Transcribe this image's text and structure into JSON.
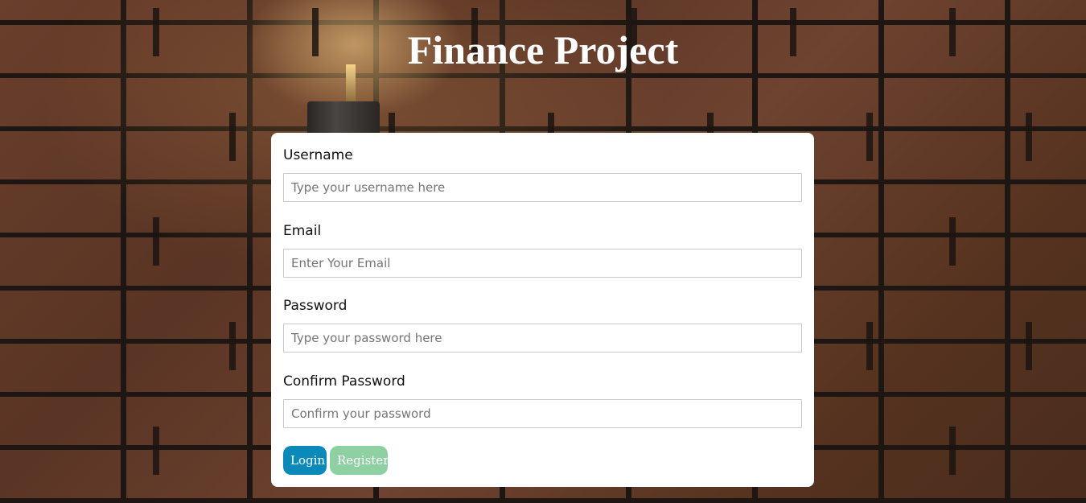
{
  "page": {
    "title": "Finance Project"
  },
  "form": {
    "username": {
      "label": "Username",
      "placeholder": "Type your username here"
    },
    "email": {
      "label": "Email",
      "placeholder": "Enter Your Email"
    },
    "password": {
      "label": "Password",
      "placeholder": "Type your password here"
    },
    "confirm_password": {
      "label": "Confirm Password",
      "placeholder": "Confirm your password"
    },
    "buttons": {
      "login": "Login",
      "register": "Register"
    }
  },
  "colors": {
    "login_button": "#0b8ab9",
    "register_button": "#8fd0a3",
    "card_background": "#ffffff",
    "title_text": "#ffffff"
  }
}
